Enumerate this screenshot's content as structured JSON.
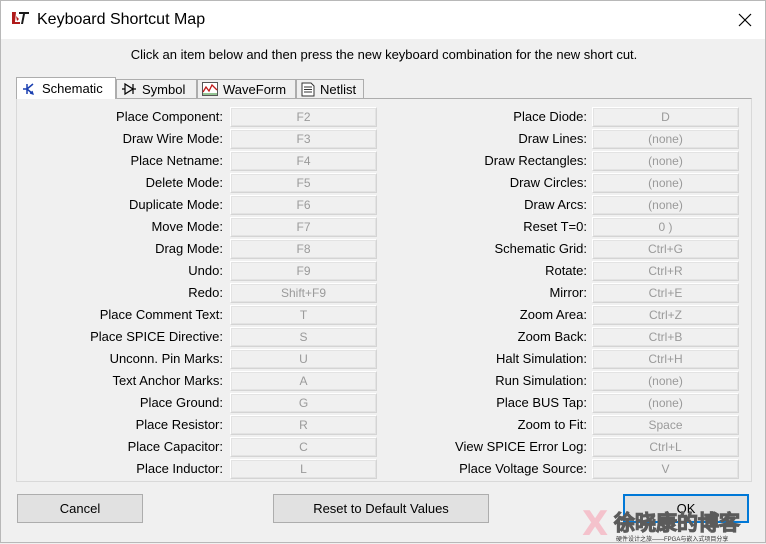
{
  "window": {
    "title": "Keyboard Shortcut Map",
    "app_icon": "ltspice-logo-icon",
    "close_icon": "close-x-icon"
  },
  "instruction": "Click an item below and then press the new keyboard combination for the new short cut.",
  "tabs": [
    {
      "label": "Schematic",
      "icon": "schematic-component-icon",
      "active": true
    },
    {
      "label": "Symbol",
      "icon": "symbol-diode-icon",
      "active": false
    },
    {
      "label": "WaveForm",
      "icon": "waveform-icon",
      "active": false
    },
    {
      "label": "Netlist",
      "icon": "netlist-document-icon",
      "active": false
    }
  ],
  "left_column": [
    {
      "label": "Place Component:",
      "key": "F2"
    },
    {
      "label": "Draw Wire Mode:",
      "key": "F3"
    },
    {
      "label": "Place Netname:",
      "key": "F4"
    },
    {
      "label": "Delete Mode:",
      "key": "F5"
    },
    {
      "label": "Duplicate Mode:",
      "key": "F6"
    },
    {
      "label": "Move Mode:",
      "key": "F7"
    },
    {
      "label": "Drag Mode:",
      "key": "F8"
    },
    {
      "label": "Undo:",
      "key": "F9"
    },
    {
      "label": "Redo:",
      "key": "Shift+F9"
    },
    {
      "label": "Place Comment Text:",
      "key": "T"
    },
    {
      "label": "Place SPICE Directive:",
      "key": "S"
    },
    {
      "label": "Unconn. Pin Marks:",
      "key": "U"
    },
    {
      "label": "Text Anchor Marks:",
      "key": "A"
    },
    {
      "label": "Place Ground:",
      "key": "G"
    },
    {
      "label": "Place Resistor:",
      "key": "R"
    },
    {
      "label": "Place Capacitor:",
      "key": "C"
    },
    {
      "label": "Place Inductor:",
      "key": "L"
    }
  ],
  "right_column": [
    {
      "label": "Place Diode:",
      "key": "D"
    },
    {
      "label": "Draw Lines:",
      "key": "(none)"
    },
    {
      "label": "Draw Rectangles:",
      "key": "(none)"
    },
    {
      "label": "Draw Circles:",
      "key": "(none)"
    },
    {
      "label": "Draw Arcs:",
      "key": "(none)"
    },
    {
      "label": "Reset T=0:",
      "key": "0 )"
    },
    {
      "label": "Schematic Grid:",
      "key": "Ctrl+G"
    },
    {
      "label": "Rotate:",
      "key": "Ctrl+R"
    },
    {
      "label": "Mirror:",
      "key": "Ctrl+E"
    },
    {
      "label": "Zoom Area:",
      "key": "Ctrl+Z"
    },
    {
      "label": "Zoom Back:",
      "key": "Ctrl+B"
    },
    {
      "label": "Halt Simulation:",
      "key": "Ctrl+H"
    },
    {
      "label": "Run Simulation:",
      "key": "(none)"
    },
    {
      "label": "Place BUS Tap:",
      "key": "(none)"
    },
    {
      "label": "Zoom to Fit:",
      "key": "Space"
    },
    {
      "label": "View SPICE Error Log:",
      "key": "Ctrl+L"
    },
    {
      "label": "Place Voltage Source:",
      "key": "V"
    }
  ],
  "buttons": {
    "cancel": "Cancel",
    "reset": "Reset to Default Values",
    "ok": "OK"
  },
  "watermark": {
    "main": "徐晓康的博客",
    "sub": "硬件设计之旅——FPGA与嵌入式项目分享"
  },
  "colors": {
    "accent": "#0078d7",
    "disabled_text": "#9a9a9a",
    "dialog_bg": "#f0f0f0"
  }
}
